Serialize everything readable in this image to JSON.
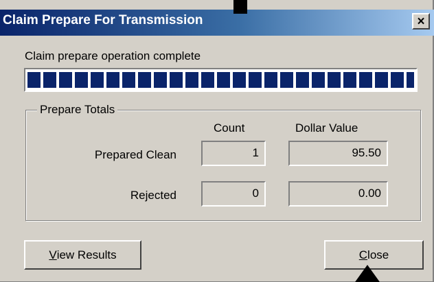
{
  "window": {
    "title": "Claim Prepare For Transmission",
    "close_glyph": "×"
  },
  "status": {
    "message": "Claim prepare operation complete",
    "progress_fraction": 1.0
  },
  "totals": {
    "group_label": "Prepare Totals",
    "columns": {
      "count": "Count",
      "dollar": "Dollar Value"
    },
    "rows": [
      {
        "label": "Prepared Clean",
        "count": "1",
        "dollar": "95.50"
      },
      {
        "label": "Rejected",
        "count": "0",
        "dollar": "0.00"
      }
    ]
  },
  "buttons": {
    "view_results": {
      "mnemonic": "V",
      "rest": "iew Results"
    },
    "close": {
      "mnemonic": "C",
      "rest": "lose"
    }
  },
  "colors": {
    "title_gradient_start": "#0a246a",
    "title_gradient_end": "#a6caf0",
    "dialog_face": "#d4d0c8",
    "progress_block": "#0a246a"
  }
}
